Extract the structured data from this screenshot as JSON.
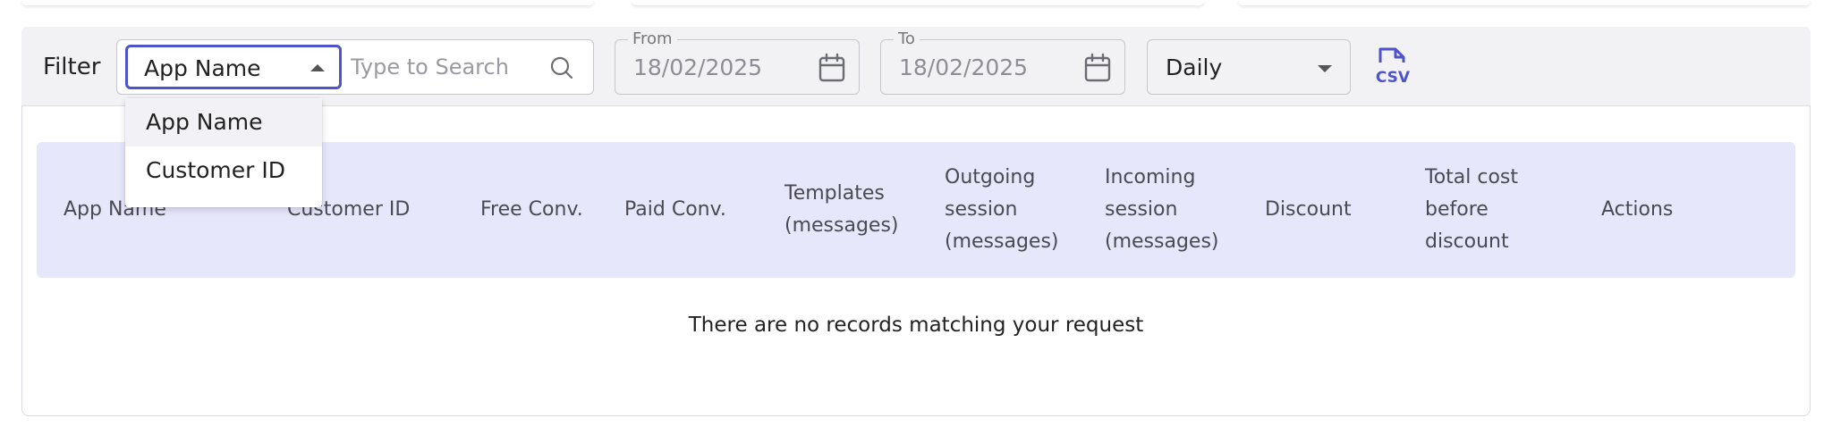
{
  "filter": {
    "label": "Filter",
    "field_select": {
      "value": "App Name",
      "options": [
        "App Name",
        "Customer ID"
      ]
    },
    "search": {
      "placeholder": "Type to Search",
      "value": ""
    },
    "from": {
      "label": "From",
      "value": "18/02/2025"
    },
    "to": {
      "label": "To",
      "value": "18/02/2025"
    },
    "period": {
      "value": "Daily"
    },
    "csv_icon": "csv-download-icon"
  },
  "table": {
    "columns": [
      [
        "App Name"
      ],
      [
        "Customer ID"
      ],
      [
        "Free Conv."
      ],
      [
        "Paid Conv."
      ],
      [
        "Templates",
        "(messages)"
      ],
      [
        "Outgoing",
        "session",
        "(messages)"
      ],
      [
        "Incoming",
        "session",
        "(messages)"
      ],
      [
        "Discount"
      ],
      [
        "Total cost",
        "before",
        "discount"
      ],
      [
        "Actions"
      ]
    ],
    "empty_message": "There are no records matching your request"
  },
  "colors": {
    "accent": "#4d53c9",
    "table_header_bg": "#e6e7fb",
    "filter_bar_bg": "#f2f2f4"
  }
}
